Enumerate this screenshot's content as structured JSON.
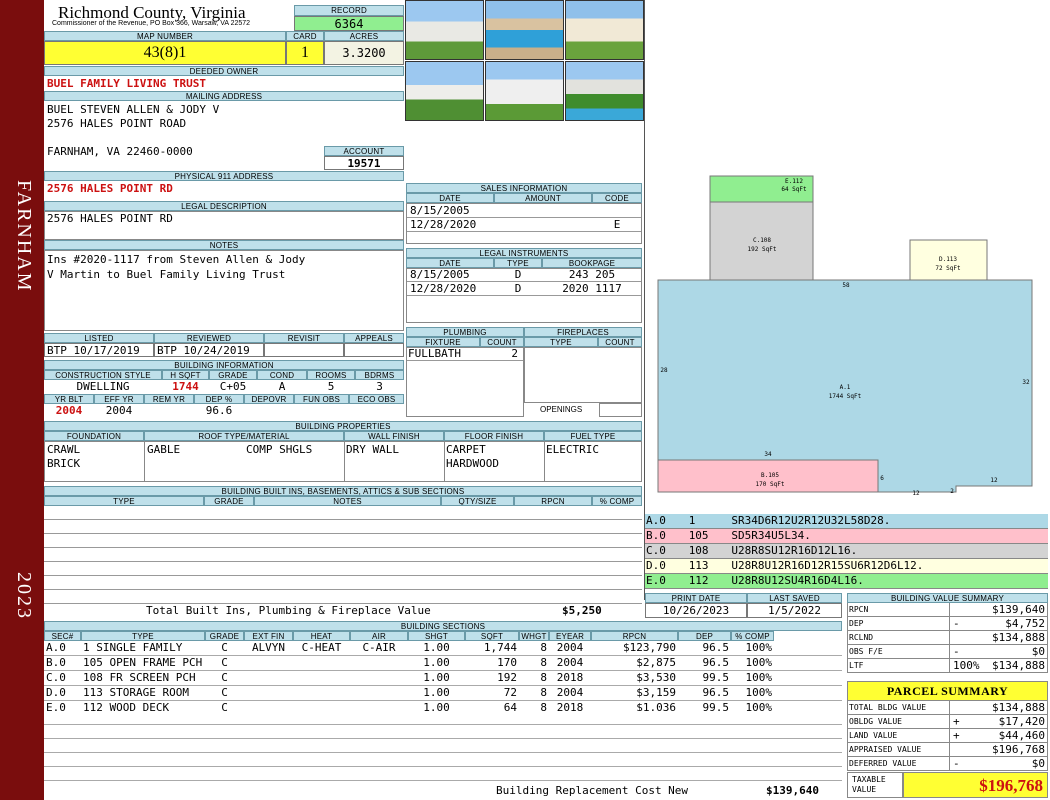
{
  "sidebar": {
    "town": "FARNHAM",
    "year": "2023"
  },
  "header": {
    "county": "Richmond County, Virginia",
    "commissioner": "Commissioner of the Revenue, PO Box 366, Warsaw, VA 22572",
    "record_label": "RECORD",
    "record": "6364",
    "map_label": "MAP NUMBER",
    "map_number": "43(8)1",
    "card_label": "CARD",
    "card": "1",
    "acres_label": "ACRES",
    "acres": "3.3200"
  },
  "owner": {
    "deeded_label": "DEEDED OWNER",
    "deeded_owner": "BUEL FAMILY LIVING TRUST",
    "mailing_label": "MAILING ADDRESS",
    "mailing": [
      "BUEL STEVEN ALLEN & JODY V",
      "2576 HALES POINT ROAD",
      "",
      "FARNHAM, VA 22460-0000"
    ],
    "account_label": "ACCOUNT",
    "account": "19571",
    "physical_label": "PHYSICAL 911 ADDRESS",
    "physical": "2576 HALES POINT RD",
    "legal_label": "LEGAL DESCRIPTION",
    "legal": "2576 HALES POINT RD",
    "notes_label": "NOTES",
    "notes": [
      "Ins #2020-1117 from Steven Allen & Jody",
      "V Martin to Buel Family Living Trust"
    ]
  },
  "review": {
    "listed_label": "LISTED",
    "listed": "BTP 10/17/2019",
    "reviewed_label": "REVIEWED",
    "reviewed": "BTP 10/24/2019",
    "revisit_label": "REVISIT",
    "revisit": "",
    "appeals_label": "APPEALS",
    "appeals": ""
  },
  "building_info": {
    "label": "BUILDING INFORMATION",
    "headers": [
      "CONSTRUCTION STYLE",
      "H SQFT",
      "GRADE",
      "COND",
      "ROOMS",
      "BDRMS"
    ],
    "values": [
      "DWELLING",
      "1744",
      "C+05",
      "A",
      "5",
      "3"
    ],
    "headers2": [
      "YR BLT",
      "EFF YR",
      "REM YR",
      "DEP %",
      "DEPOVR",
      "FUN OBS",
      "ECO OBS"
    ],
    "values2": [
      "2004",
      "2004",
      "",
      "96.6",
      "",
      "",
      ""
    ]
  },
  "sales": {
    "label": "SALES INFORMATION",
    "headers": [
      "DATE",
      "AMOUNT",
      "CODE"
    ],
    "rows": [
      [
        "8/15/2005",
        "",
        ""
      ],
      [
        "12/28/2020",
        "",
        "E"
      ]
    ]
  },
  "legal_instruments": {
    "label": "LEGAL INSTRUMENTS",
    "headers": [
      "DATE",
      "TYPE",
      "BOOKPAGE"
    ],
    "rows": [
      [
        "8/15/2005",
        "D",
        "243 205"
      ],
      [
        "12/28/2020",
        "D",
        "2020 1117"
      ]
    ]
  },
  "plumbing": {
    "label": "PLUMBING",
    "headers": [
      "FIXTURE",
      "COUNT"
    ],
    "rows": [
      [
        "FULLBATH",
        "2"
      ]
    ]
  },
  "fireplaces": {
    "label": "FIREPLACES",
    "headers": [
      "TYPE",
      "COUNT"
    ],
    "openings_label": "OPENINGS"
  },
  "properties": {
    "label": "BUILDING PROPERTIES",
    "headers": [
      "FOUNDATION",
      "ROOF TYPE/MATERIAL",
      "WALL FINISH",
      "FLOOR FINISH",
      "FUEL TYPE"
    ],
    "foundation": [
      "CRAWL",
      "BRICK"
    ],
    "roof_type": "GABLE",
    "roof_material": "COMP SHGLS",
    "wall": "DRY WALL",
    "floor": [
      "CARPET",
      "HARDWOOD"
    ],
    "fuel": "ELECTRIC"
  },
  "builtins": {
    "label": "BUILDING BUILT INS, BASEMENTS, ATTICS & SUB SECTIONS",
    "headers": [
      "TYPE",
      "GRADE",
      "NOTES",
      "QTY/SIZE",
      "RPCN",
      "% COMP"
    ],
    "total_label": "Total Built Ins, Plumbing & Fireplace Value",
    "total": "$5,250"
  },
  "sketch": {
    "areas": [
      {
        "code": "E.112",
        "sqft": "64 SqFt"
      },
      {
        "code": "C.108",
        "sqft": "192 SqFt"
      },
      {
        "code": "D.113",
        "sqft": "72 SqFt"
      },
      {
        "code": "A.1",
        "sqft": "1744 SqFt"
      },
      {
        "code": "B.105",
        "sqft": "170 SqFt"
      }
    ],
    "dims": [
      "58",
      "28",
      "32",
      "34",
      "6",
      "12",
      "2",
      "12"
    ],
    "legend": [
      {
        "sec": "A.0",
        "num": "1",
        "path": "SR34D6R12U2R12U32L58D28.",
        "color": "#add8e6"
      },
      {
        "sec": "B.0",
        "num": "105",
        "path": "SD5R34U5L34.",
        "color": "#ffc0cb"
      },
      {
        "sec": "C.0",
        "num": "108",
        "path": "U28R8SU12R16D12L16.",
        "color": "#d3d3d3"
      },
      {
        "sec": "D.0",
        "num": "113",
        "path": "U28R8U12R16D12R15SU6R12D6L12.",
        "color": "#ffffe0"
      },
      {
        "sec": "E.0",
        "num": "112",
        "path": "U28R8U12SU4R16D4L16.",
        "color": "#90ee90"
      }
    ]
  },
  "print": {
    "print_label": "PRINT DATE",
    "print_date": "10/26/2023",
    "saved_label": "LAST SAVED",
    "last_saved": "1/5/2022"
  },
  "sections": {
    "label": "BUILDING SECTIONS",
    "headers": [
      "SEC#",
      "TYPE",
      "GRADE",
      "EXT FIN",
      "HEAT",
      "AIR",
      "SHGT",
      "SQFT",
      "WHGT",
      "EYEAR",
      "RPCN",
      "DEP",
      "% COMP"
    ],
    "rows": [
      [
        "A.0",
        "1 SINGLE FAMILY",
        "C",
        "ALVYN",
        "C-HEAT",
        "C-AIR",
        "1.00",
        "1,744",
        "8",
        "2004",
        "$123,790",
        "96.5",
        "100%"
      ],
      [
        "B.0",
        "105 OPEN FRAME PCH",
        "C",
        "",
        "",
        "",
        "1.00",
        "170",
        "8",
        "2004",
        "$2,875",
        "96.5",
        "100%"
      ],
      [
        "C.0",
        "108 FR SCREEN PCH",
        "C",
        "",
        "",
        "",
        "1.00",
        "192",
        "8",
        "2018",
        "$3,530",
        "99.5",
        "100%"
      ],
      [
        "D.0",
        "113 STORAGE ROOM",
        "C",
        "",
        "",
        "",
        "1.00",
        "72",
        "8",
        "2004",
        "$3,159",
        "96.5",
        "100%"
      ],
      [
        "E.0",
        "112 WOOD DECK",
        "C",
        "",
        "",
        "",
        "1.00",
        "64",
        "8",
        "2018",
        "$1,036",
        "99.5",
        "100%"
      ]
    ],
    "rcn_label": "Building Replacement Cost New",
    "rcn": "$139,640"
  },
  "bvs": {
    "label": "BUILDING VALUE SUMMARY",
    "rows": [
      {
        "label": "RPCN",
        "sign": "",
        "value": "$139,640"
      },
      {
        "label": "DEP",
        "sign": "-",
        "value": "$4,752"
      },
      {
        "label": "RCLND",
        "sign": "",
        "value": "$134,888"
      },
      {
        "label": "OBS F/E",
        "sign": "-",
        "value": "$0"
      },
      {
        "label": "LTF",
        "sign": "100%",
        "value": "$134,888"
      }
    ]
  },
  "parcel": {
    "title": "PARCEL SUMMARY",
    "rows": [
      {
        "label": "TOTAL BLDG VALUE",
        "sign": "",
        "value": "$134,888"
      },
      {
        "label": "OBLDG VALUE",
        "sign": "+",
        "value": "$17,420"
      },
      {
        "label": "LAND VALUE",
        "sign": "+",
        "value": "$44,460"
      },
      {
        "label": "APPRAISED VALUE",
        "sign": "",
        "value": "$196,768"
      },
      {
        "label": "DEFERRED VALUE",
        "sign": "-",
        "value": "$0"
      }
    ],
    "taxable_label": "TAXABLE VALUE",
    "taxable": "$196,768"
  }
}
